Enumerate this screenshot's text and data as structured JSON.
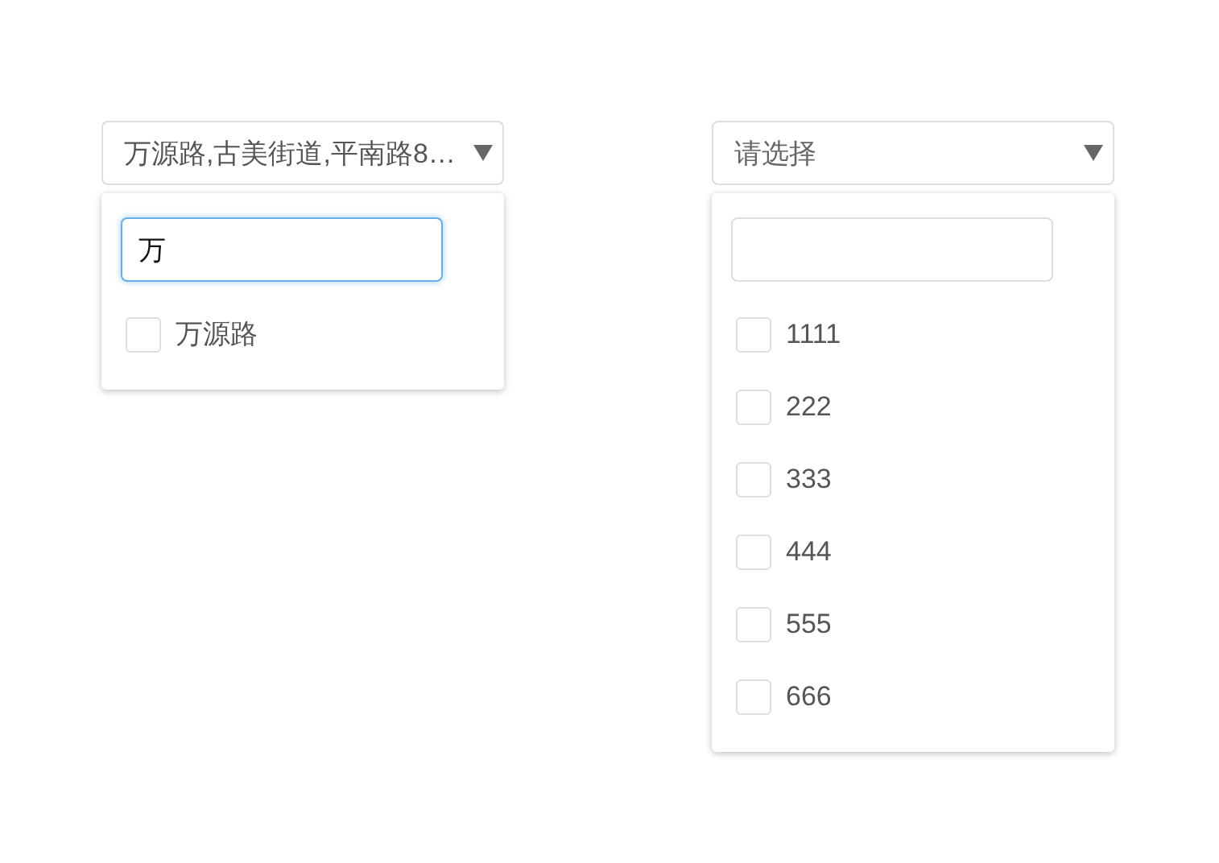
{
  "selects": [
    {
      "value": "万源路,古美街道,平南路8…",
      "search": {
        "value": "万",
        "focused": true
      },
      "options": [
        {
          "label": "万源路",
          "checked": false
        }
      ]
    },
    {
      "placeholder": "请选择",
      "search": {
        "focused": false
      },
      "options": [
        {
          "label": "1111",
          "checked": false
        },
        {
          "label": "222",
          "checked": false
        },
        {
          "label": "333",
          "checked": false
        },
        {
          "label": "444",
          "checked": false
        },
        {
          "label": "555",
          "checked": false
        },
        {
          "label": "666",
          "checked": false
        }
      ]
    }
  ]
}
